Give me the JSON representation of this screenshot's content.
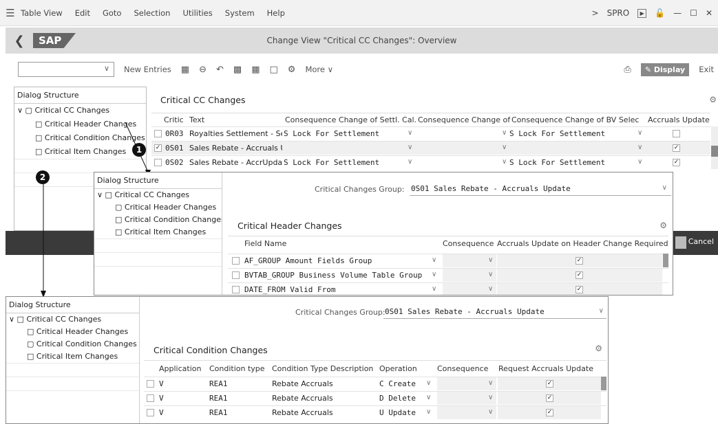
{
  "menu": [
    "Table View",
    "Edit",
    "Goto",
    "Selection",
    "Utilities",
    "System",
    "Help"
  ],
  "menu_right": {
    "arrow": ">",
    "transaction": "SPRO"
  },
  "title": "Change View \"Critical CC Changes\": Overview",
  "toolbar": {
    "new_entries": "New Entries",
    "more": "More",
    "display": "Display",
    "exit": "Exit"
  },
  "dialog": {
    "title": "Dialog Structure",
    "items": [
      "Critical CC Changes",
      "Critical Header Changes",
      "Critical Condition Changes",
      "Critical Item Changes"
    ]
  },
  "main": {
    "section": "Critical CC Changes",
    "cols": [
      "Critic",
      "Text",
      "Consequence Change of Settl. Cal.",
      "Consequence Change of ext",
      "Consequence Change of BV Selec",
      "Accruals Update"
    ],
    "rows": [
      {
        "code": "0R03",
        "text": "Royalties Settlement - Sett",
        "c1": "S Lock For Settlement",
        "c2": "",
        "c3": "S Lock For Settlement",
        "acc": false,
        "sel": false
      },
      {
        "code": "0S01",
        "text": "Sales Rebate - Accruals Up",
        "c1": "",
        "c2": "",
        "c3": "",
        "acc": true,
        "sel": true
      },
      {
        "code": "0S02",
        "text": "Sales Rebate - AccrUpdate",
        "c1": "S Lock For Settlement",
        "c2": "",
        "c3": "S Lock For Settlement",
        "acc": true,
        "sel": false
      }
    ]
  },
  "callouts": [
    "1",
    "2"
  ],
  "header_win": {
    "group_label": "Critical Changes Group:",
    "group_value": "0S01 Sales Rebate - Accruals Update",
    "section": "Critical Header Changes",
    "cols": [
      "Field Name",
      "Consequence",
      "Accruals Update on Header Change Required"
    ],
    "rows": [
      "AF_GROUP Amount Fields Group",
      "BVTAB_GROUP Business Volume Table Group",
      "DATE_FROM Valid From"
    ],
    "cancel": "Cancel"
  },
  "cond_win": {
    "group_label": "Critical Changes Group:",
    "group_value": "0S01 Sales Rebate - Accruals Update",
    "section": "Critical Condition Changes",
    "cols": [
      "Application",
      "Condition type",
      "Condition Type Description",
      "Operation",
      "Consequence",
      "Request Accruals Update"
    ],
    "rows": [
      {
        "app": "V",
        "ctype": "REA1",
        "desc": "Rebate Accruals",
        "op": "C Create"
      },
      {
        "app": "V",
        "ctype": "REA1",
        "desc": "Rebate Accruals",
        "op": "D Delete"
      },
      {
        "app": "V",
        "ctype": "REA1",
        "desc": "Rebate Accruals",
        "op": "U Update"
      }
    ]
  }
}
